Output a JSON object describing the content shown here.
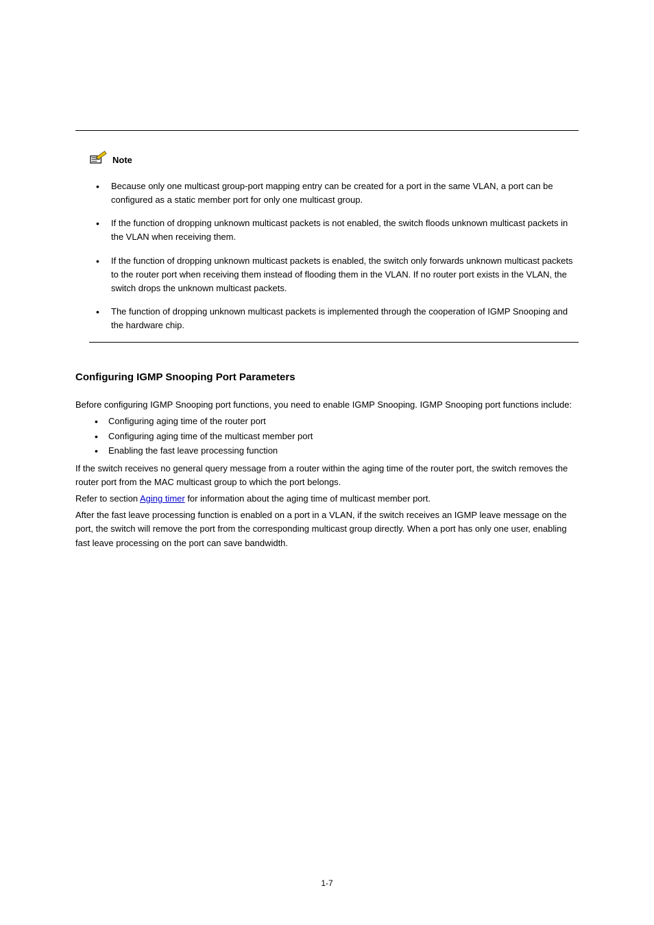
{
  "note": {
    "label": "Note",
    "items": [
      "Because only one multicast group-port mapping entry can be created for a port in the same VLAN, a port can be configured as a static member port for only one multicast group.",
      "If the function of dropping unknown multicast packets is not enabled, the switch floods unknown multicast packets in the VLAN when receiving them.",
      "If the function of dropping unknown multicast packets is enabled, the switch only forwards unknown multicast packets to the router port when receiving them instead of flooding them in the VLAN. If no router port exists in the VLAN, the switch drops the unknown multicast packets.",
      "The function of dropping unknown multicast packets is implemented through the cooperation of IGMP Snooping and the hardware chip."
    ]
  },
  "section": {
    "heading": "Configuring IGMP Snooping Port Parameters",
    "intro": "Before configuring IGMP Snooping port functions, you need to enable IGMP Snooping. IGMP Snooping port functions include:",
    "bullets": [
      "Configuring aging time of the router port",
      "Configuring aging time of the multicast member port",
      "Enabling the fast leave processing function"
    ],
    "p1": "If the switch receives no general query message from a router within the aging time of the router port, the switch removes the router port from the MAC multicast group to which the port belongs.",
    "p2_before_link": "Refer to section ",
    "p2_link": "Aging timer",
    "p2_after_link": " for information about the aging time of multicast member port.",
    "p3": "After the fast leave processing function is enabled on a port in a VLAN, if the switch receives an IGMP leave message on the port, the switch will remove the port from the corresponding multicast group directly. When a port has only one user, enabling fast leave processing on the port can save bandwidth."
  },
  "page_number": "1-7"
}
